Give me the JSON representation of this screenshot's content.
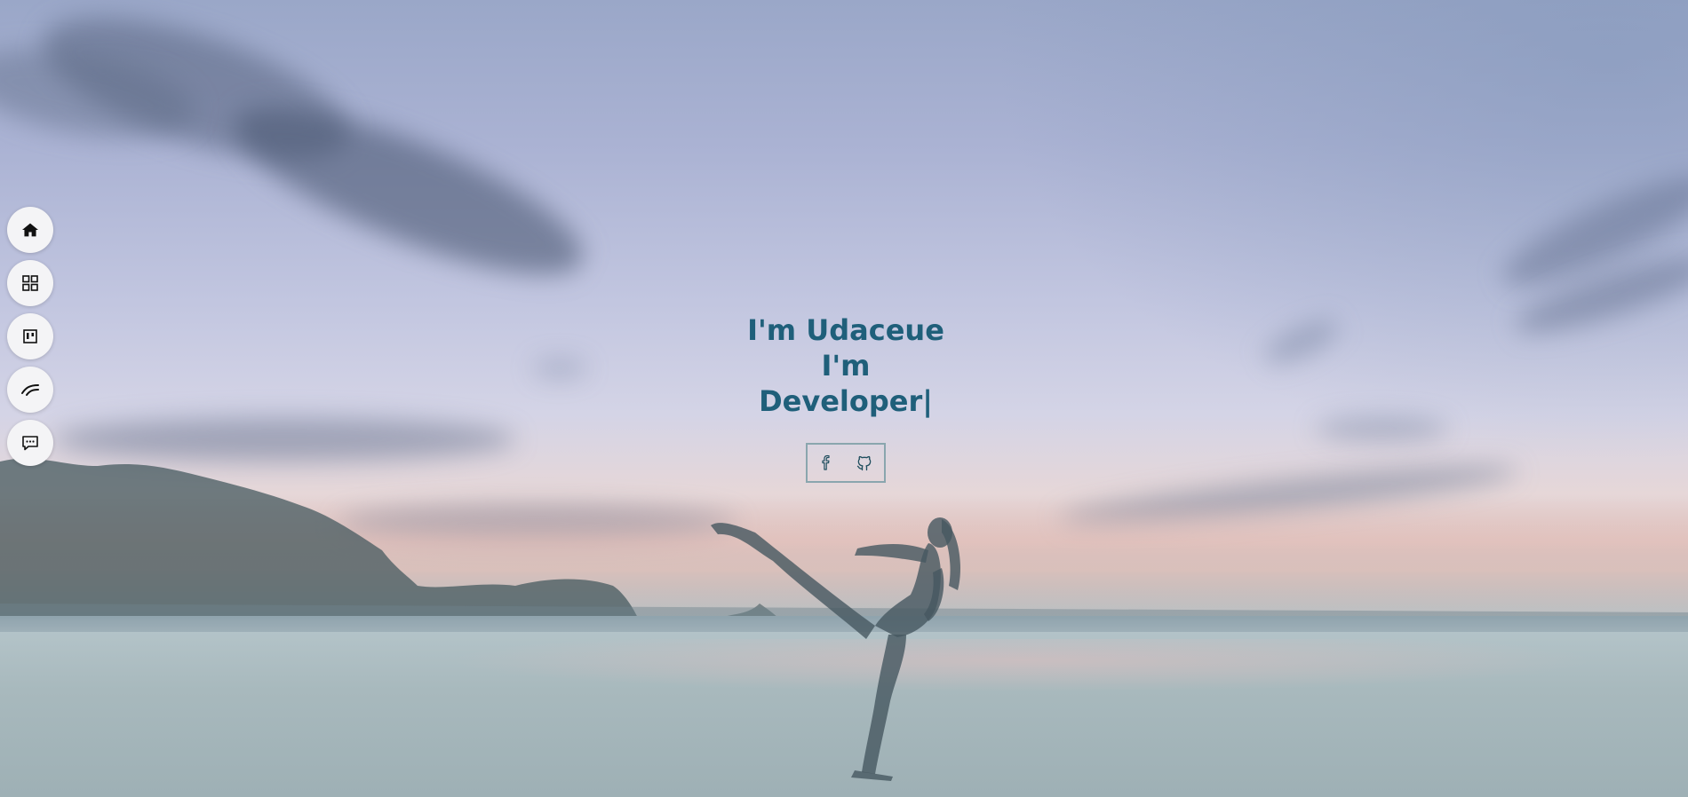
{
  "hero": {
    "headline_line1": "I'm Udaceue",
    "headline_line2": "I'm",
    "headline_line3": "Developer|",
    "text_color": "#1f5f7a"
  },
  "social": {
    "links": [
      {
        "icon": "facebook-icon"
      },
      {
        "icon": "github-icon"
      }
    ],
    "border_color": "#8aa6ae"
  },
  "sidenav": {
    "items": [
      {
        "icon": "home-icon"
      },
      {
        "icon": "grid-icon"
      },
      {
        "icon": "board-icon"
      },
      {
        "icon": "wave-icon"
      },
      {
        "icon": "chat-icon"
      }
    ],
    "button_color": "#f4f4f6"
  }
}
